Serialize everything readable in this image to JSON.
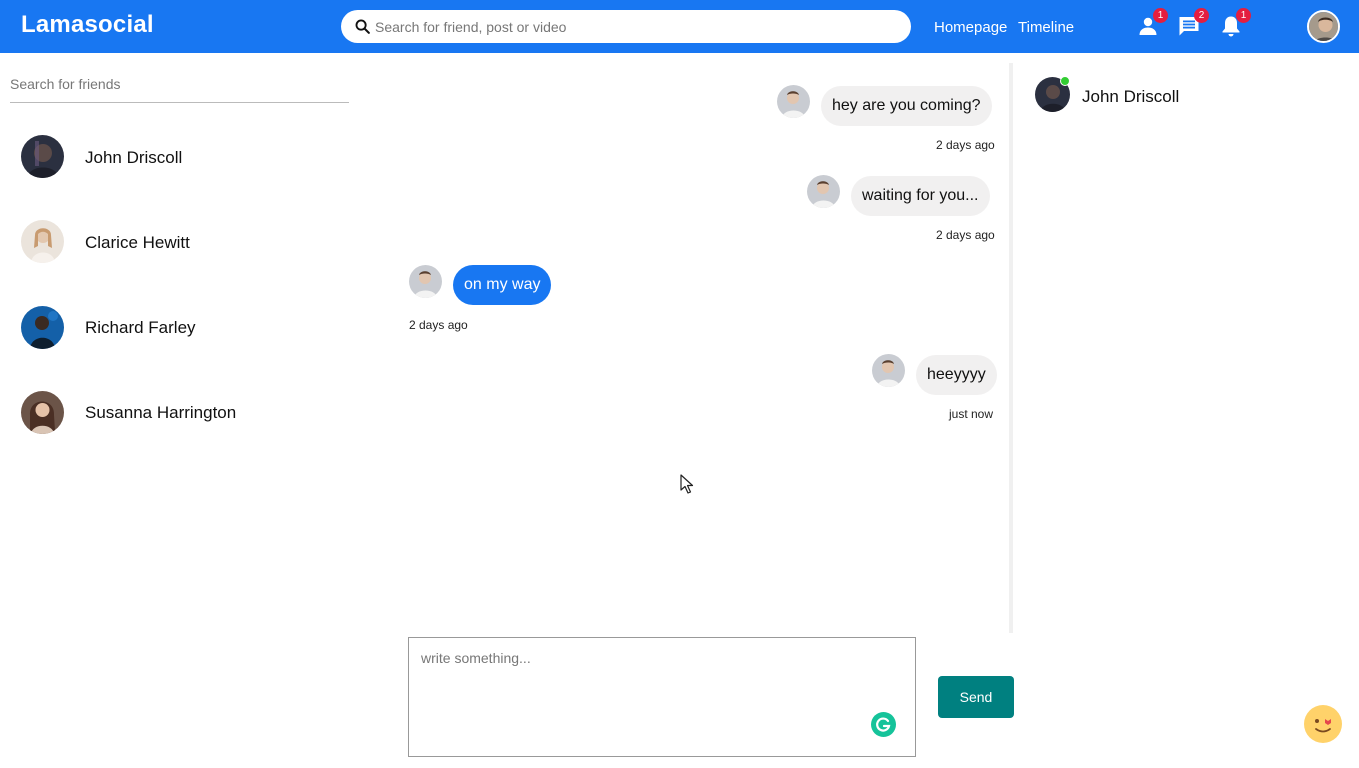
{
  "header": {
    "logo": "Lamasocial",
    "search_placeholder": "Search for friend, post or video",
    "links": [
      "Homepage",
      "Timeline"
    ],
    "badges": {
      "friends": "1",
      "messages": "2",
      "notifications": "1"
    },
    "accent_color": "#1877f2"
  },
  "sidebar": {
    "search_placeholder": "Search for friends",
    "friends": [
      {
        "name": "John Driscoll"
      },
      {
        "name": "Clarice Hewitt"
      },
      {
        "name": "Richard Farley"
      },
      {
        "name": "Susanna Harrington"
      }
    ]
  },
  "chat": {
    "messages": [
      {
        "text": "hey are you coming?",
        "time": "2 days ago",
        "own": false
      },
      {
        "text": "waiting for you...",
        "time": "2 days ago",
        "own": false
      },
      {
        "text": "on my way",
        "time": "2 days ago",
        "own": true
      },
      {
        "text": "heeyyyy",
        "time": "just now",
        "own": false
      }
    ],
    "input_placeholder": "write something...",
    "send_label": "Send"
  },
  "online_friends": [
    {
      "name": "John Driscoll",
      "online": true
    }
  ]
}
